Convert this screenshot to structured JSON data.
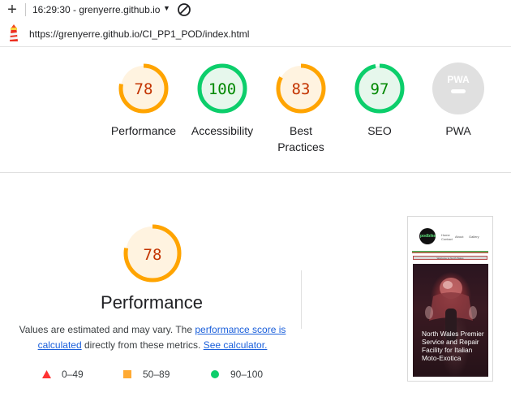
{
  "toolbar": {
    "time_host": "16:29:30 - grenyerre.github.io",
    "url": "https://grenyerre.github.io/CI_PP1_POD/index.html"
  },
  "categories": [
    {
      "id": "performance",
      "label": "Performance",
      "score": "78",
      "status": "average"
    },
    {
      "id": "accessibility",
      "label": "Accessibility",
      "score": "100",
      "status": "pass"
    },
    {
      "id": "best-practices",
      "label": "Best Practices",
      "score": "83",
      "status": "average"
    },
    {
      "id": "seo",
      "label": "SEO",
      "score": "97",
      "status": "pass"
    },
    {
      "id": "pwa",
      "label": "PWA",
      "badge": "PWA",
      "status": "na"
    }
  ],
  "performance": {
    "score": "78",
    "title": "Performance",
    "desc_pre": "Values are estimated and may vary. The ",
    "link1": "performance score is calculated",
    "desc_mid": " directly from these metrics. ",
    "link2": "See calculator."
  },
  "legend": [
    {
      "range": "0–49",
      "shape": "triangle",
      "color": "#ff3333"
    },
    {
      "range": "50–89",
      "shape": "square",
      "color": "#ffaa33"
    },
    {
      "range": "90–100",
      "shape": "circle",
      "color": "#0cce6b"
    }
  ],
  "thumbnail": {
    "logo_text": "podbike",
    "nav": [
      "Home",
      "About",
      "Gallery"
    ],
    "nav_extra": "Contact",
    "banner": "Welcome to North Wales",
    "hero_text": "North Wales Premier Service and Repair Facility for Italian Moto-Exotica"
  },
  "colors": {
    "average": "#ffa400",
    "average_fill": "#fff3e0",
    "average_text": "#c33300",
    "pass": "#0cce6b",
    "pass_fill": "#e6f7ec",
    "pass_text": "#008800",
    "na": "#e0e0e0",
    "link": "#1a5fdb"
  }
}
